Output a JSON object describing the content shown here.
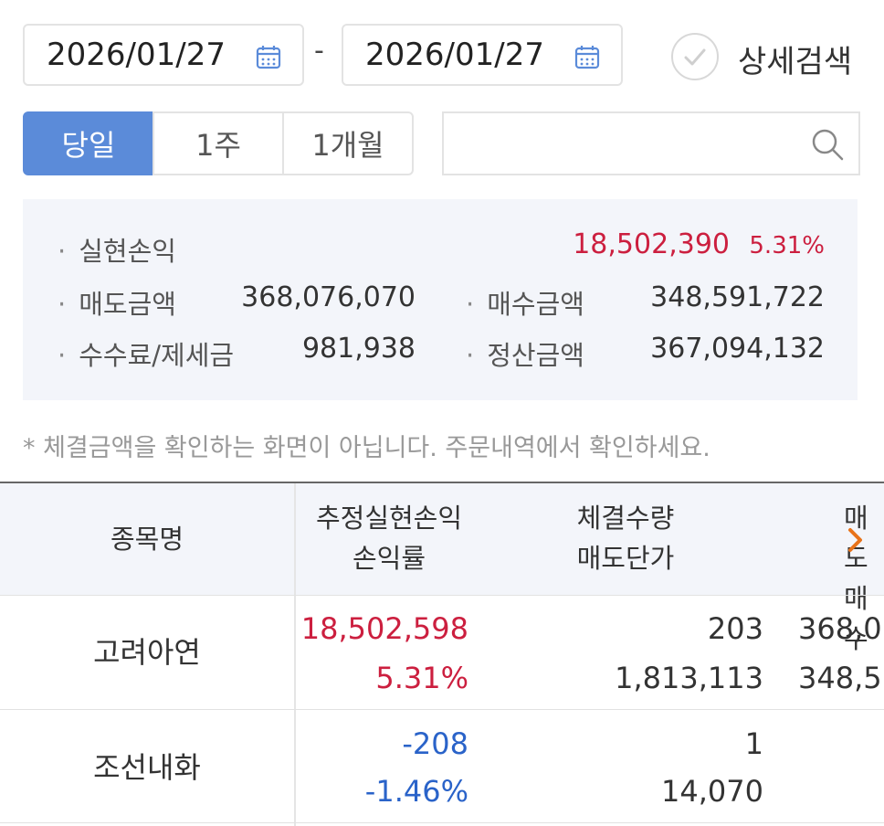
{
  "date_range": {
    "start": "2026/01/27",
    "separator": "-",
    "end": "2026/01/27",
    "calendar_icon": "calendar-icon"
  },
  "detail_search": {
    "label": "상세검색",
    "icon": "check-circle-icon"
  },
  "period_tabs": [
    {
      "label": "당일",
      "active": true
    },
    {
      "label": "1주",
      "active": false
    },
    {
      "label": "1개월",
      "active": false
    }
  ],
  "search": {
    "value": "",
    "placeholder": "",
    "icon": "search-icon"
  },
  "summary": {
    "realized_pl": {
      "label": "실현손익",
      "value": "18,502,390",
      "rate": "5.31%"
    },
    "sell_amount": {
      "label": "매도금액",
      "value": "368,076,070"
    },
    "buy_amount": {
      "label": "매수금액",
      "value": "348,591,722"
    },
    "fees_taxes": {
      "label": "수수료/제세금",
      "value": "981,938"
    },
    "settlement_amount": {
      "label": "정산금액",
      "value": "367,094,132"
    },
    "bullet": "·"
  },
  "notice": "* 체결금액을 확인하는 화면이 아닙니다. 주문내역에서 확인하세요.",
  "table": {
    "headers": {
      "name": "종목명",
      "pl_line1": "추정실현손익",
      "pl_line2": "손익률",
      "qty_line1": "체결수량",
      "qty_line2": "매도단가",
      "amt_line1": "매도",
      "amt_line2": "매수"
    },
    "rows": [
      {
        "name": "고려아연",
        "pl": "18,502,598",
        "rate": "5.31%",
        "qty": "203",
        "price": "1,813,113",
        "sell_amt": "368,0",
        "buy_amt": "348,5"
      },
      {
        "name": "조선내화",
        "pl": "-208",
        "rate": "-1.46%",
        "qty": "1",
        "price": "14,070",
        "sell_amt": "",
        "buy_amt": ""
      }
    ]
  },
  "colors": {
    "accent": "#5b8bd9",
    "gain": "#cc1f3f",
    "loss": "#2a63c9",
    "panel_bg": "#f3f5fa",
    "scroll_hint": "#e8731a"
  }
}
